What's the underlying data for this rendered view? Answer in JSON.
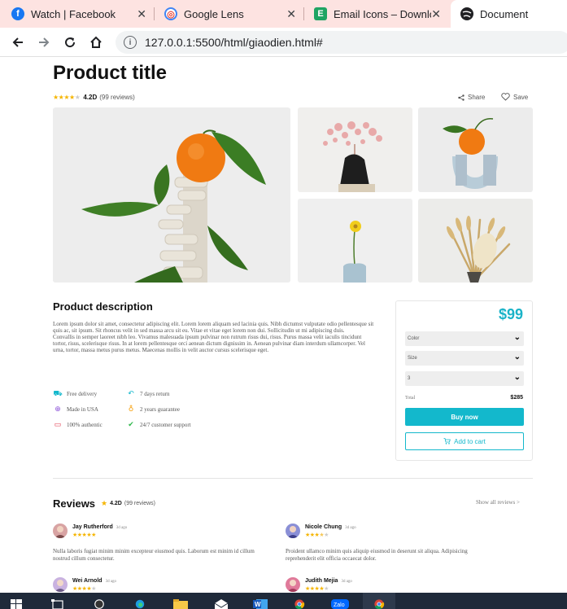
{
  "browser": {
    "tabs": [
      {
        "label": "Watch | Facebook",
        "icon": "facebook-icon",
        "color": "#1877f2",
        "glyph": "f"
      },
      {
        "label": "Google Lens",
        "icon": "google-lens-icon",
        "color": "#ea4335",
        "glyph": "◎"
      },
      {
        "label": "Email Icons – Downloa",
        "icon": "email-icons-favicon",
        "color": "#1fa463",
        "glyph": "E"
      },
      {
        "label": "Document",
        "icon": "globe-icon",
        "color": "#202124",
        "glyph": "●"
      }
    ],
    "close_glyph": "✕",
    "url": "127.0.0.1:5500/html/giaodien.html#"
  },
  "product": {
    "title": "Product title",
    "rating": "4.2D",
    "reviews_count": "(99 reviews)",
    "share_label": "Share",
    "save_label": "Save",
    "gallery": [
      {
        "name": "orange-on-sculpture-image",
        "alt": "orange on stacked ceramic sculpture with leaves"
      },
      {
        "name": "pink-dried-flowers-image",
        "alt": "pink dried flowers on black stone"
      },
      {
        "name": "orange-on-blue-vase-image",
        "alt": "orange on blue wavy vase"
      },
      {
        "name": "yellow-flower-vase-image",
        "alt": "yellow flower in blue vase"
      },
      {
        "name": "dried-grass-bouquet-image",
        "alt": "dried grass bouquet"
      }
    ]
  },
  "description": {
    "title": "Product description",
    "text": "Lorem ipsum dolor sit amet, consectetur adipiscing elit. Lorem lorem aliquam sed lacinia quis. Nibh dictumst vulputate odio pellentesque sit quis ac, sit ipsum. Sit rhoncus velit in sed massa arcu sit eu. Vitae et vitae eget lorem non dui. Sollicitudin ut mi adipiscing duis.",
    "text2": "Convallis in semper laoreet nibh leo. Vivamus malesuada ipsum pulvinar non rutrum risus dui, risus. Purus massa velit iaculis tincidunt tortor, risus, scelerisque risus. In at lorem pellentesque orci aenean dictum dignissim in. Aenean pulvinar diam interdum ullamcorper. Vel urna, tortor, massa metus purus metus. Maecenas mollis in velit auctor cursus scelerisque eget.",
    "features": [
      {
        "label": "Free delivery",
        "icon": "truck-icon",
        "glyph": "⛟",
        "color": "#13b8cc"
      },
      {
        "label": "7 days return",
        "icon": "return-arrow-icon",
        "glyph": "↶",
        "color": "#13b8cc"
      },
      {
        "label": "Made in USA",
        "icon": "globe-icon",
        "glyph": "⊕",
        "color": "#8a4fd8"
      },
      {
        "label": "2 years guarantee",
        "icon": "medal-icon",
        "glyph": "♁",
        "color": "#f59b00"
      },
      {
        "label": "100% authentic",
        "icon": "chat-icon",
        "glyph": "▭",
        "color": "#e0354a"
      },
      {
        "label": "24/7 customer support",
        "icon": "check-icon",
        "glyph": "✔✔",
        "color": "#2eb84b"
      }
    ]
  },
  "purchase": {
    "price": "$99",
    "color_label": "Color",
    "size_label": "Size",
    "quantity_value": "3",
    "chevron_glyph": "⌄",
    "total_label": "Total",
    "total_value": "$285",
    "buy_label": "Buy now",
    "cart_label": "Add to cart"
  },
  "reviews": {
    "title": "Reviews",
    "rating": "4.2D",
    "count": "(99 reviews)",
    "show_all": "Show all reviews >",
    "items": [
      {
        "name": "Jay Rutherford",
        "time": "3d ago",
        "stars": 5,
        "text": "Nulla laboris fugiat minim minim excepteur eiusmod quis. Laborum est minim id cillum nostrud cillum consectetur.",
        "avatar_color": "#d8a3a3"
      },
      {
        "name": "Nicole Chung",
        "time": "3d ago",
        "stars": 3.5,
        "text": "Proident ullamco minim quis aliquip eiusmod in deserunt sit aliqua. Adipisicing reprehenderit elit officia occaecat dolor.",
        "avatar_color": "#8a8fd6"
      },
      {
        "name": "Wei Arnold",
        "time": "3d ago",
        "stars": 4,
        "text": "",
        "avatar_color": "#c9b2e0"
      },
      {
        "name": "Judith Mejia",
        "time": "3d ago",
        "stars": 4,
        "text": "",
        "avatar_color": "#e07a9a"
      }
    ]
  },
  "taskbar": {
    "items": [
      {
        "name": "windows-start-icon"
      },
      {
        "name": "task-view-icon"
      },
      {
        "name": "obs-icon"
      },
      {
        "name": "edge-icon"
      },
      {
        "name": "file-explorer-icon"
      },
      {
        "name": "mail-icon"
      },
      {
        "name": "word-icon"
      },
      {
        "name": "chrome-icon"
      },
      {
        "name": "zalo-icon",
        "label": "Zalo"
      },
      {
        "name": "chrome-active-icon"
      }
    ]
  }
}
